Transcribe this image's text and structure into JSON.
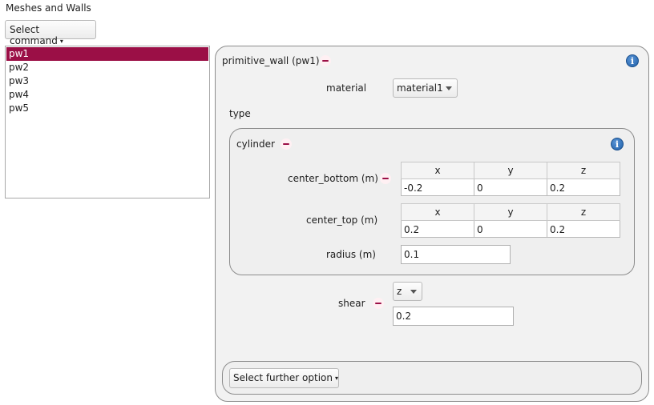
{
  "header": {
    "title": "Meshes and Walls"
  },
  "command": {
    "label": "Select command",
    "caret": "▾"
  },
  "list": {
    "items": [
      "pw1",
      "pw2",
      "pw3",
      "pw4",
      "pw5"
    ],
    "selected_index": 0
  },
  "wall": {
    "title": "primitive_wall (pw1)",
    "material_label": "material",
    "material_value": "material1",
    "type_label": "type",
    "cylinder": {
      "title": "cylinder",
      "center_bottom": {
        "label": "center_bottom (m)",
        "headers": [
          "x",
          "y",
          "z"
        ],
        "values": [
          "-0.2",
          "0",
          "0.2"
        ]
      },
      "center_top": {
        "label": "center_top (m)",
        "headers": [
          "x",
          "y",
          "z"
        ],
        "values": [
          "0.2",
          "0",
          "0.2"
        ]
      },
      "radius": {
        "label": "radius (m)",
        "value": "0.1"
      }
    },
    "shear": {
      "label": "shear",
      "axis": "z",
      "value": "0.2"
    },
    "further_option": "Select further option"
  },
  "icons": {
    "info": "info-icon",
    "remove": "minus-icon",
    "dropdown": "chevron-down-icon"
  },
  "colors": {
    "selection": "#9b0f46",
    "minus": "#9b0f46",
    "info": "#1f5fa8"
  }
}
